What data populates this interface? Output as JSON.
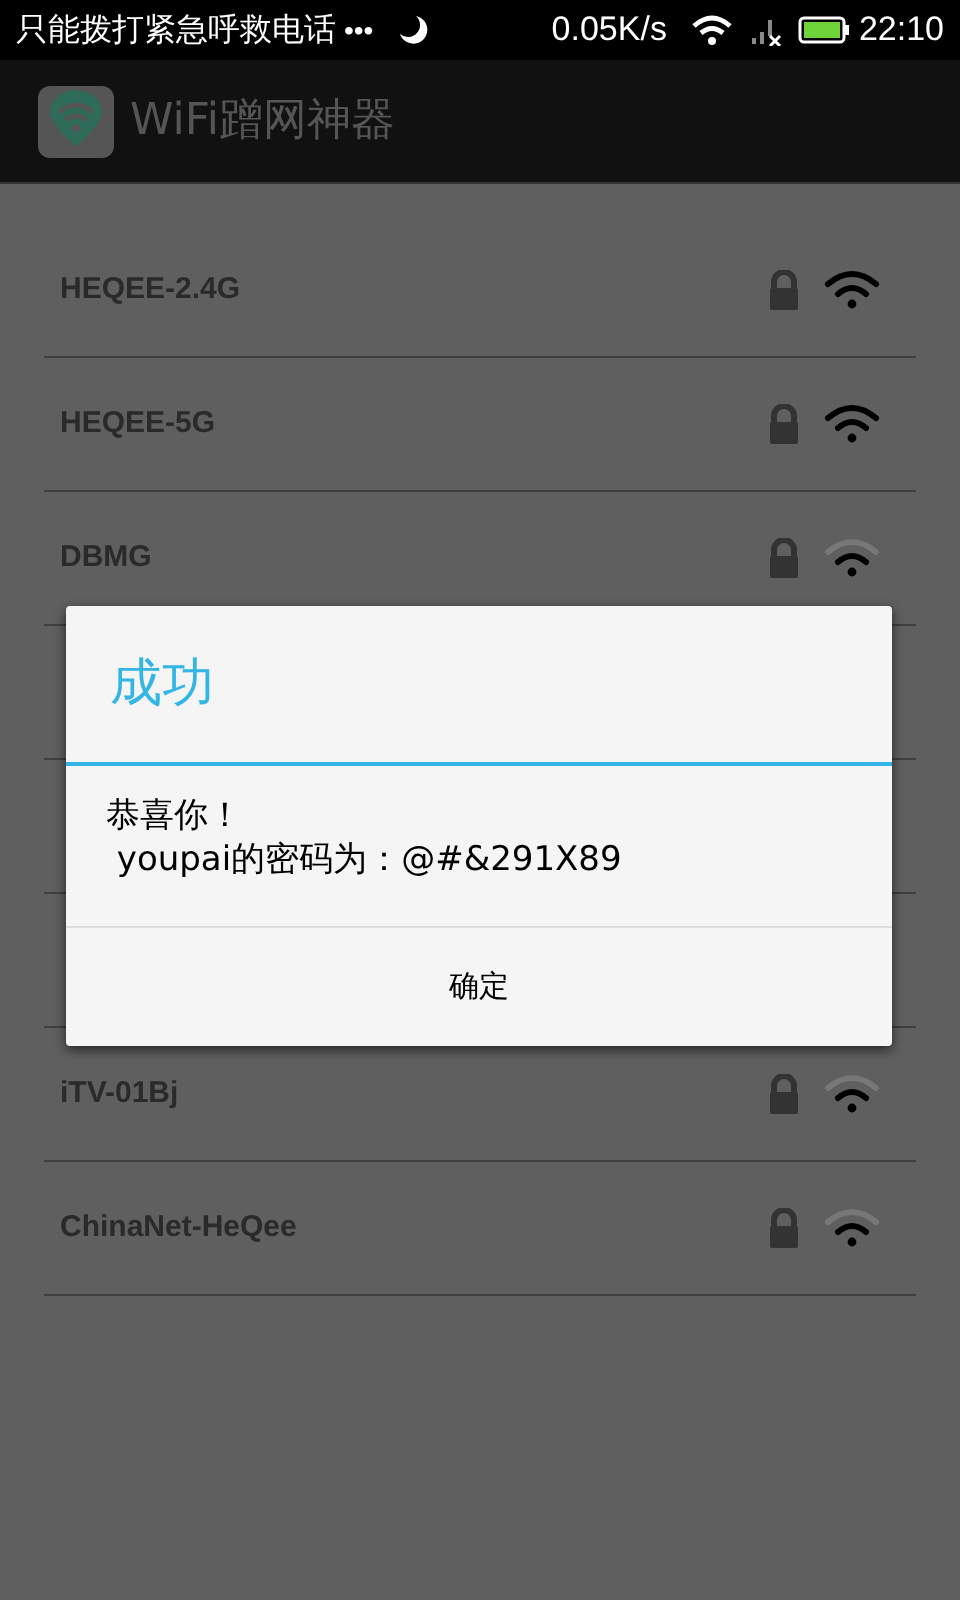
{
  "status_bar": {
    "notice": "只能拨打紧急呼救电话",
    "dots": "•••",
    "speed": "0.05K/s",
    "time": "22:10"
  },
  "app_bar": {
    "title": "WiFi蹭网神器"
  },
  "networks": [
    {
      "name": "HEQEE-2.4G",
      "kind": "strong"
    },
    {
      "name": "HEQEE-5G",
      "kind": "strong"
    },
    {
      "name": "DBMG",
      "kind": "weak"
    },
    {
      "kind": "hidden"
    },
    {
      "kind": "hidden"
    },
    {
      "kind": "hidden"
    },
    {
      "name": "iTV-01Bj",
      "kind": "weak"
    },
    {
      "name": "ChinaNet-HeQee",
      "kind": "weak"
    }
  ],
  "dialog": {
    "title": "成功",
    "message": "恭喜你！",
    "detail": " youpai的密码为：@#&291X89",
    "button": "确定"
  }
}
